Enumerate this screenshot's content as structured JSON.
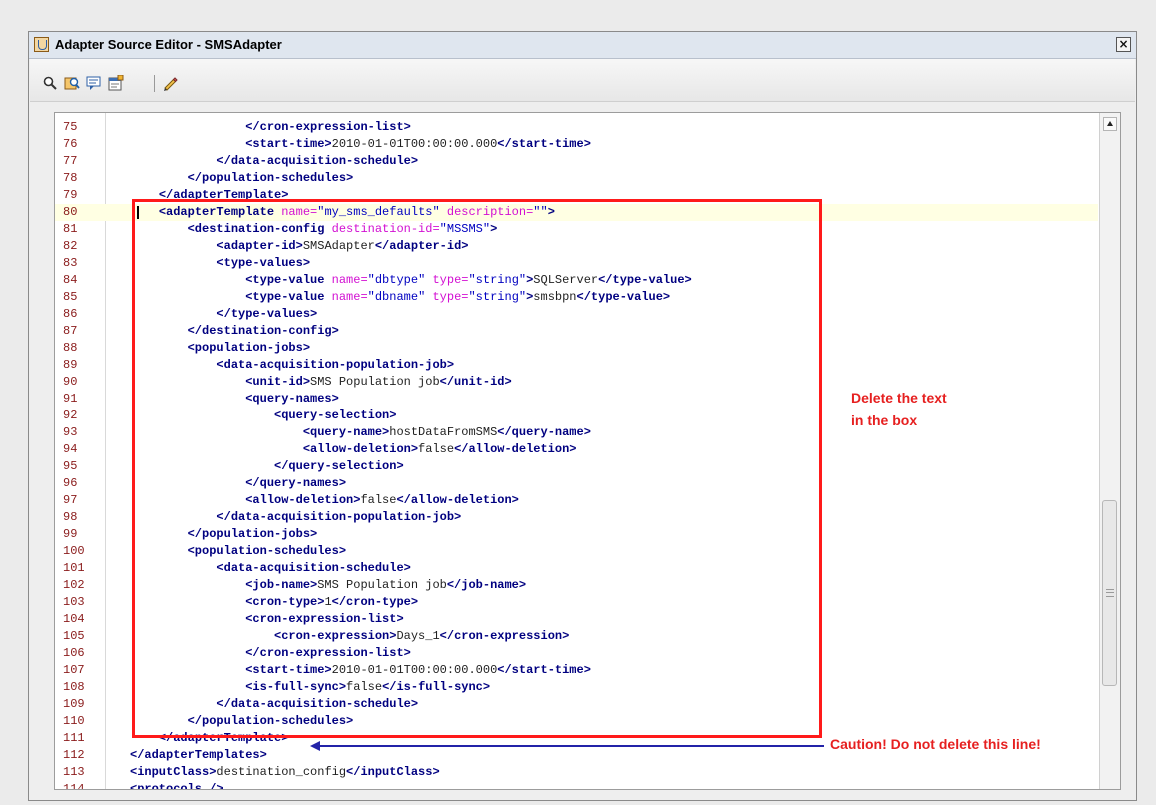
{
  "window": {
    "title": "Adapter Source Editor - SMSAdapter",
    "close_label": "×"
  },
  "toolbar": {
    "icons": [
      "search-icon",
      "find-replace-icon",
      "comment-icon",
      "properties-icon",
      "edit-pencil-icon"
    ]
  },
  "editor": {
    "highlighted_line": 80,
    "lines": [
      {
        "n": "75",
        "parts": [
          [
            "x",
            "                "
          ],
          [
            "t",
            "</cron-expression-list>"
          ]
        ]
      },
      {
        "n": "76",
        "parts": [
          [
            "x",
            "                "
          ],
          [
            "t",
            "<start-time>"
          ],
          [
            "x",
            "2010-01-01T00:00:00.000"
          ],
          [
            "t",
            "</start-time>"
          ]
        ]
      },
      {
        "n": "77",
        "parts": [
          [
            "x",
            "            "
          ],
          [
            "t",
            "</data-acquisition-schedule>"
          ]
        ]
      },
      {
        "n": "78",
        "parts": [
          [
            "x",
            "        "
          ],
          [
            "t",
            "</population-schedules>"
          ]
        ]
      },
      {
        "n": "79",
        "parts": [
          [
            "x",
            "    "
          ],
          [
            "t",
            "</adapterTemplate>"
          ]
        ]
      },
      {
        "n": "80",
        "parts": [
          [
            "x",
            "    "
          ],
          [
            "t",
            "<adapterTemplate "
          ],
          [
            "a",
            "name="
          ],
          [
            "v",
            "\"my_sms_defaults\""
          ],
          [
            "a",
            " description="
          ],
          [
            "v",
            "\"\""
          ],
          [
            "t",
            ">"
          ]
        ]
      },
      {
        "n": "81",
        "parts": [
          [
            "x",
            "        "
          ],
          [
            "t",
            "<destination-config "
          ],
          [
            "a",
            "destination-id="
          ],
          [
            "v",
            "\"MSSMS\""
          ],
          [
            "t",
            ">"
          ]
        ]
      },
      {
        "n": "82",
        "parts": [
          [
            "x",
            "            "
          ],
          [
            "t",
            "<adapter-id>"
          ],
          [
            "x",
            "SMSAdapter"
          ],
          [
            "t",
            "</adapter-id>"
          ]
        ]
      },
      {
        "n": "83",
        "parts": [
          [
            "x",
            "            "
          ],
          [
            "t",
            "<type-values>"
          ]
        ]
      },
      {
        "n": "84",
        "parts": [
          [
            "x",
            "                "
          ],
          [
            "t",
            "<type-value "
          ],
          [
            "a",
            "name="
          ],
          [
            "v",
            "\"dbtype\""
          ],
          [
            "a",
            " type="
          ],
          [
            "v",
            "\"string\""
          ],
          [
            "t",
            ">"
          ],
          [
            "x",
            "SQLServer"
          ],
          [
            "t",
            "</type-value>"
          ]
        ]
      },
      {
        "n": "85",
        "parts": [
          [
            "x",
            "                "
          ],
          [
            "t",
            "<type-value "
          ],
          [
            "a",
            "name="
          ],
          [
            "v",
            "\"dbname\""
          ],
          [
            "a",
            " type="
          ],
          [
            "v",
            "\"string\""
          ],
          [
            "t",
            ">"
          ],
          [
            "x",
            "smsbpn"
          ],
          [
            "t",
            "</type-value>"
          ]
        ]
      },
      {
        "n": "86",
        "parts": [
          [
            "x",
            "            "
          ],
          [
            "t",
            "</type-values>"
          ]
        ]
      },
      {
        "n": "87",
        "parts": [
          [
            "x",
            "        "
          ],
          [
            "t",
            "</destination-config>"
          ]
        ]
      },
      {
        "n": "88",
        "parts": [
          [
            "x",
            "        "
          ],
          [
            "t",
            "<population-jobs>"
          ]
        ]
      },
      {
        "n": "89",
        "parts": [
          [
            "x",
            "            "
          ],
          [
            "t",
            "<data-acquisition-population-job>"
          ]
        ]
      },
      {
        "n": "90",
        "parts": [
          [
            "x",
            "                "
          ],
          [
            "t",
            "<unit-id>"
          ],
          [
            "x",
            "SMS Population job"
          ],
          [
            "t",
            "</unit-id>"
          ]
        ]
      },
      {
        "n": "91",
        "parts": [
          [
            "x",
            "                "
          ],
          [
            "t",
            "<query-names>"
          ]
        ]
      },
      {
        "n": "92",
        "parts": [
          [
            "x",
            "                    "
          ],
          [
            "t",
            "<query-selection>"
          ]
        ]
      },
      {
        "n": "93",
        "parts": [
          [
            "x",
            "                        "
          ],
          [
            "t",
            "<query-name>"
          ],
          [
            "x",
            "hostDataFromSMS"
          ],
          [
            "t",
            "</query-name>"
          ]
        ]
      },
      {
        "n": "94",
        "parts": [
          [
            "x",
            "                        "
          ],
          [
            "t",
            "<allow-deletion>"
          ],
          [
            "x",
            "false"
          ],
          [
            "t",
            "</allow-deletion>"
          ]
        ]
      },
      {
        "n": "95",
        "parts": [
          [
            "x",
            "                    "
          ],
          [
            "t",
            "</query-selection>"
          ]
        ]
      },
      {
        "n": "96",
        "parts": [
          [
            "x",
            "                "
          ],
          [
            "t",
            "</query-names>"
          ]
        ]
      },
      {
        "n": "97",
        "parts": [
          [
            "x",
            "                "
          ],
          [
            "t",
            "<allow-deletion>"
          ],
          [
            "x",
            "false"
          ],
          [
            "t",
            "</allow-deletion>"
          ]
        ]
      },
      {
        "n": "98",
        "parts": [
          [
            "x",
            "            "
          ],
          [
            "t",
            "</data-acquisition-population-job>"
          ]
        ]
      },
      {
        "n": "99",
        "parts": [
          [
            "x",
            "        "
          ],
          [
            "t",
            "</population-jobs>"
          ]
        ]
      },
      {
        "n": "100",
        "parts": [
          [
            "x",
            "        "
          ],
          [
            "t",
            "<population-schedules>"
          ]
        ]
      },
      {
        "n": "101",
        "parts": [
          [
            "x",
            "            "
          ],
          [
            "t",
            "<data-acquisition-schedule>"
          ]
        ]
      },
      {
        "n": "102",
        "parts": [
          [
            "x",
            "                "
          ],
          [
            "t",
            "<job-name>"
          ],
          [
            "x",
            "SMS Population job"
          ],
          [
            "t",
            "</job-name>"
          ]
        ]
      },
      {
        "n": "103",
        "parts": [
          [
            "x",
            "                "
          ],
          [
            "t",
            "<cron-type>"
          ],
          [
            "x",
            "1"
          ],
          [
            "t",
            "</cron-type>"
          ]
        ]
      },
      {
        "n": "104",
        "parts": [
          [
            "x",
            "                "
          ],
          [
            "t",
            "<cron-expression-list>"
          ]
        ]
      },
      {
        "n": "105",
        "parts": [
          [
            "x",
            "                    "
          ],
          [
            "t",
            "<cron-expression>"
          ],
          [
            "x",
            "Days_1"
          ],
          [
            "t",
            "</cron-expression>"
          ]
        ]
      },
      {
        "n": "106",
        "parts": [
          [
            "x",
            "                "
          ],
          [
            "t",
            "</cron-expression-list>"
          ]
        ]
      },
      {
        "n": "107",
        "parts": [
          [
            "x",
            "                "
          ],
          [
            "t",
            "<start-time>"
          ],
          [
            "x",
            "2010-01-01T00:00:00.000"
          ],
          [
            "t",
            "</start-time>"
          ]
        ]
      },
      {
        "n": "108",
        "parts": [
          [
            "x",
            "                "
          ],
          [
            "t",
            "<is-full-sync>"
          ],
          [
            "x",
            "false"
          ],
          [
            "t",
            "</is-full-sync>"
          ]
        ]
      },
      {
        "n": "109",
        "parts": [
          [
            "x",
            "            "
          ],
          [
            "t",
            "</data-acquisition-schedule>"
          ]
        ]
      },
      {
        "n": "110",
        "parts": [
          [
            "x",
            "        "
          ],
          [
            "t",
            "</population-schedules>"
          ]
        ]
      },
      {
        "n": "111",
        "parts": [
          [
            "x",
            "    "
          ],
          [
            "t",
            "</adapterTemplate>"
          ]
        ]
      },
      {
        "n": "112",
        "parts": [
          [
            "t",
            "</adapterTemplates>"
          ]
        ]
      },
      {
        "n": "113",
        "parts": [
          [
            "t",
            "<inputClass>"
          ],
          [
            "x",
            "destination_config"
          ],
          [
            "t",
            "</inputClass>"
          ]
        ]
      },
      {
        "n": "114",
        "parts": [
          [
            "t",
            "<protocols />"
          ]
        ]
      }
    ]
  },
  "annotations": {
    "delete_note_line1": "Delete the text",
    "delete_note_line2": "in the box",
    "caution_note": "Caution! Do not delete this line!",
    "box_color": "#ff1a1a",
    "arrow_color": "#2323a8"
  }
}
